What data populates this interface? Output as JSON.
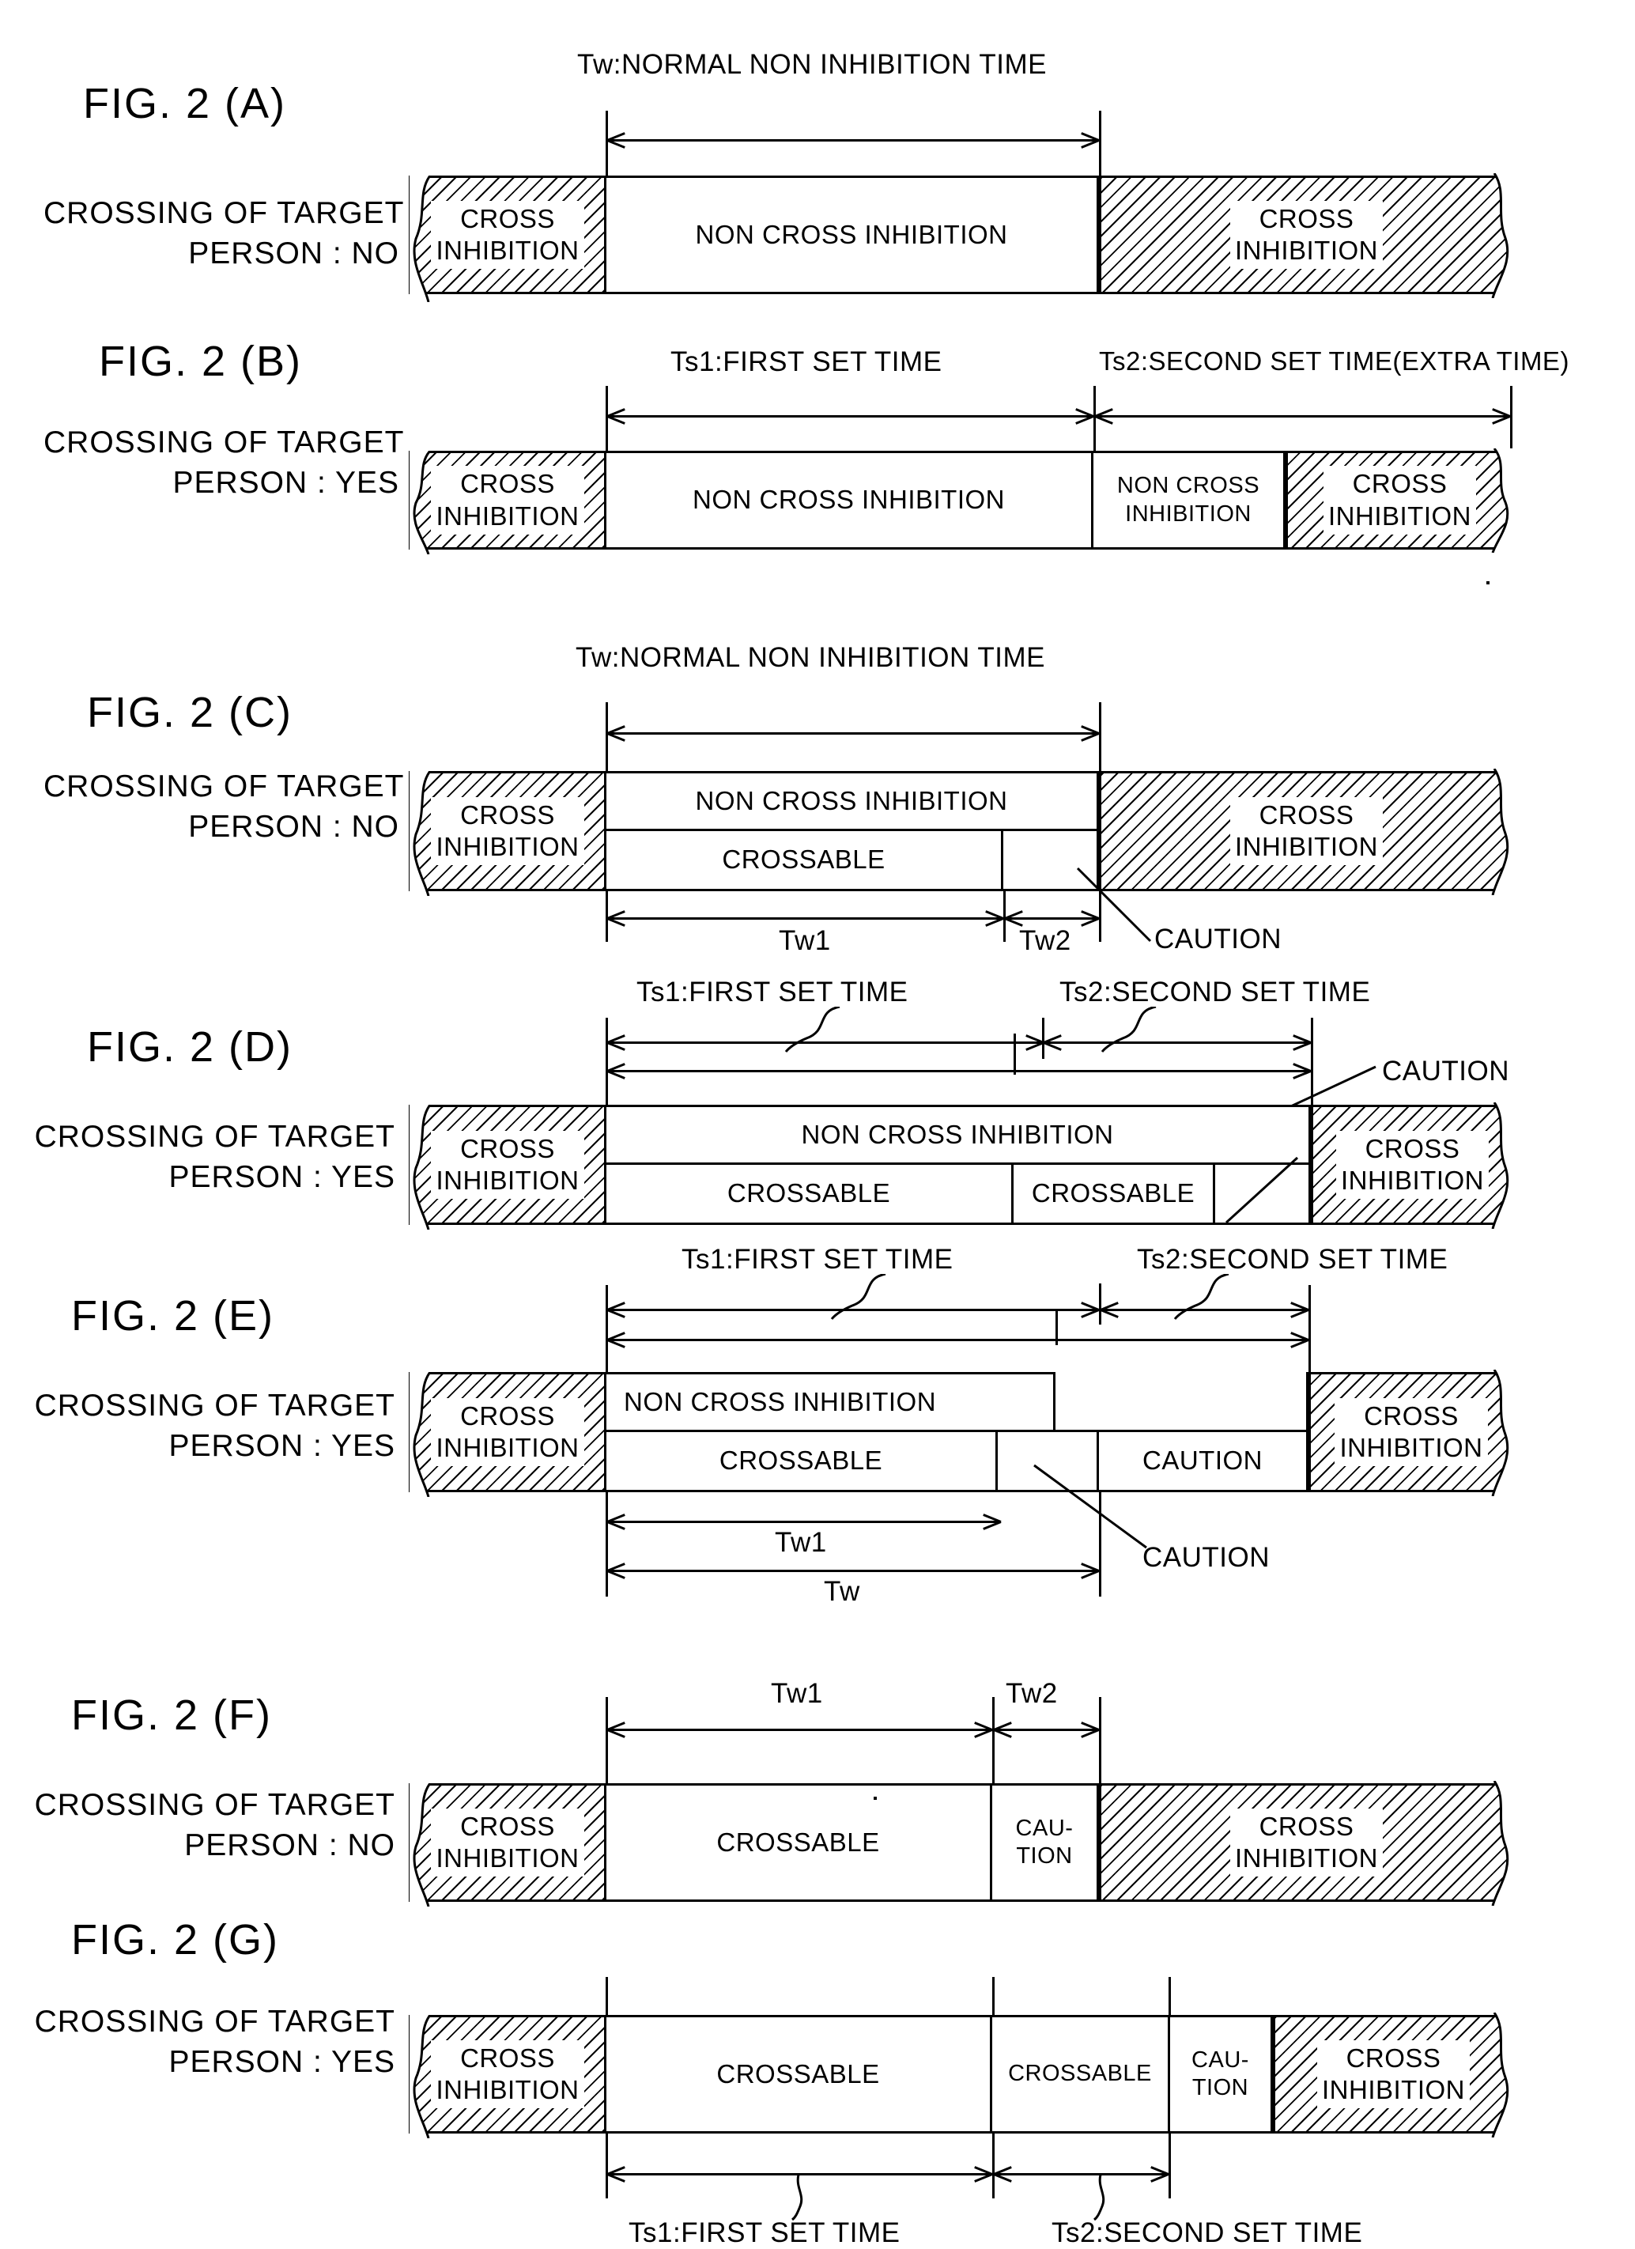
{
  "figure": {
    "id": "FIG. 2",
    "panels": [
      {
        "key": "A",
        "label": "FIG. 2 (A)",
        "condition_line1": "CROSSING OF TARGET",
        "condition_line2": "PERSON : NO",
        "top_caption": "Tw:NORMAL NON INHIBITION TIME",
        "cells": [
          "CROSS INHIBITION",
          "NON CROSS INHIBITION",
          "CROSS INHIBITION"
        ],
        "cells_split": [
          {
            "l1": "CROSS",
            "l2": "INHIBITION"
          },
          {
            "l1": "NON CROSS INHIBITION",
            "l2": ""
          },
          {
            "l1": "CROSS",
            "l2": "INHIBITION"
          }
        ]
      },
      {
        "key": "B",
        "label": "FIG. 2 (B)",
        "condition_line1": "CROSSING OF TARGET",
        "condition_line2": "PERSON : YES",
        "caption_ts1": "Ts1:FIRST SET TIME",
        "caption_ts2": "Ts2:SECOND SET TIME(EXTRA TIME)",
        "cells_split": [
          {
            "l1": "CROSS",
            "l2": "INHIBITION"
          },
          {
            "l1": "NON CROSS INHIBITION",
            "l2": ""
          },
          {
            "l1": "NON CROSS",
            "l2": "INHIBITION"
          },
          {
            "l1": "CROSS",
            "l2": "INHIBITION"
          }
        ]
      },
      {
        "key": "C",
        "label": "FIG. 2 (C)",
        "condition_line1": "CROSSING OF TARGET",
        "condition_line2": "PERSON : NO",
        "top_caption": "Tw:NORMAL NON INHIBITION TIME",
        "row_top": [
          "CROSS INHIBITION",
          "NON CROSS INHIBITION",
          "CROSS INHIBITION"
        ],
        "row_bottom": [
          "CROSSABLE"
        ],
        "tick_tw1": "Tw1",
        "tick_tw2": "Tw2",
        "caution": "CAUTION",
        "cells_split": [
          {
            "l1": "CROSS",
            "l2": "INHIBITION"
          },
          {
            "l1": "NON CROSS INHIBITION",
            "l2": ""
          },
          {
            "l1": "CROSSABLE",
            "l2": ""
          },
          {
            "l1": "CROSS",
            "l2": "INHIBITION"
          }
        ]
      },
      {
        "key": "D",
        "label": "FIG. 2 (D)",
        "condition_line1": "CROSSING OF TARGET",
        "condition_line2": "PERSON : YES",
        "caption_ts1": "Ts1:FIRST SET TIME",
        "caption_ts2": "Ts2:SECOND SET TIME",
        "caution": "CAUTION",
        "cells_split": [
          {
            "l1": "CROSS",
            "l2": "INHIBITION"
          },
          {
            "l1": "NON CROSS INHIBITION",
            "l2": ""
          },
          {
            "l1": "CROSSABLE",
            "l2": ""
          },
          {
            "l1": "CROSSABLE",
            "l2": ""
          },
          {
            "l1": "CROSS",
            "l2": "INHIBITION"
          }
        ]
      },
      {
        "key": "E",
        "label": "FIG. 2 (E)",
        "condition_line1": "CROSSING OF TARGET",
        "condition_line2": "PERSON : YES",
        "caption_ts1": "Ts1:FIRST SET TIME",
        "caption_ts2": "Ts2:SECOND SET TIME",
        "tick_tw1": "Tw1",
        "tick_tw": "Tw",
        "caution": "CAUTION",
        "cells_split": [
          {
            "l1": "CROSS",
            "l2": "INHIBITION"
          },
          {
            "l1": "NON CROSS INHIBITION",
            "l2": ""
          },
          {
            "l1": "CROSSABLE",
            "l2": ""
          },
          {
            "l1": "CAUTION",
            "l2": ""
          },
          {
            "l1": "CROSS",
            "l2": "INHIBITION"
          }
        ]
      },
      {
        "key": "F",
        "label": "FIG. 2 (F)",
        "condition_line1": "CROSSING OF TARGET",
        "condition_line2": "PERSON : NO",
        "tick_tw1": "Tw1",
        "tick_tw2": "Tw2",
        "cells_split": [
          {
            "l1": "CROSS",
            "l2": "INHIBITION"
          },
          {
            "l1": "CROSSABLE",
            "l2": ""
          },
          {
            "l1": "CAU-",
            "l2": "TION"
          },
          {
            "l1": "CROSS",
            "l2": "INHIBITION"
          }
        ]
      },
      {
        "key": "G",
        "label": "FIG. 2 (G)",
        "condition_line1": "CROSSING OF TARGET",
        "condition_line2": "PERSON : YES",
        "caption_ts1": "Ts1:FIRST SET TIME",
        "caption_ts2": "Ts2:SECOND SET TIME",
        "cells_split": [
          {
            "l1": "CROSS",
            "l2": "INHIBITION"
          },
          {
            "l1": "CROSSABLE",
            "l2": ""
          },
          {
            "l1": "CROSSABLE",
            "l2": ""
          },
          {
            "l1": "CAU-",
            "l2": "TION"
          },
          {
            "l1": "CROSS",
            "l2": "INHIBITION"
          }
        ]
      }
    ]
  }
}
